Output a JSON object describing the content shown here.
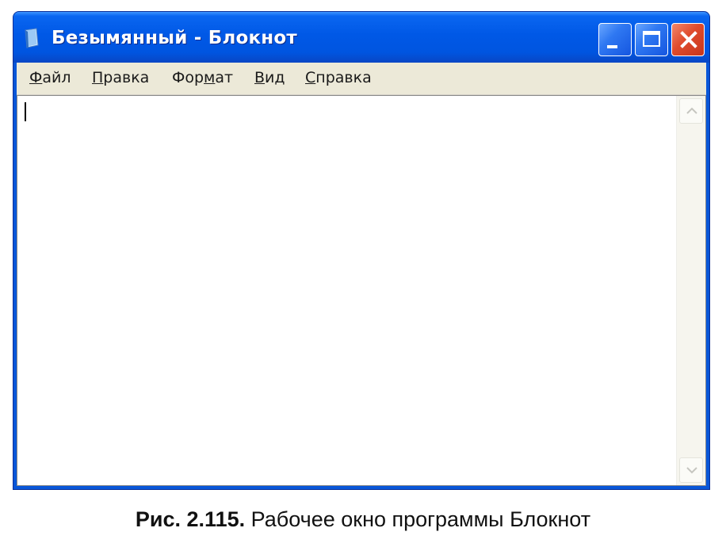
{
  "window": {
    "title": "Безымянный - Блокнот",
    "icon": "notepad-icon",
    "buttons": [
      "minimize-icon",
      "maximize-icon",
      "close-icon"
    ]
  },
  "menu": {
    "items": [
      {
        "before": "",
        "accel": "Ф",
        "after": "айл"
      },
      {
        "before": "",
        "accel": "П",
        "after": "равка"
      },
      {
        "before": "Фор",
        "accel": "м",
        "after": "ат"
      },
      {
        "before": "",
        "accel": "В",
        "after": "ид"
      },
      {
        "before": "",
        "accel": "С",
        "after": "правка"
      }
    ]
  },
  "editor": {
    "text": ""
  },
  "caption": {
    "figure": "Рис. 2.115.",
    "text": " Рабочее окно программы Блокнот"
  },
  "colors": {
    "titlebar": "#0055e0",
    "menubar": "#ece9d8",
    "close_button": "#df4b2c"
  }
}
